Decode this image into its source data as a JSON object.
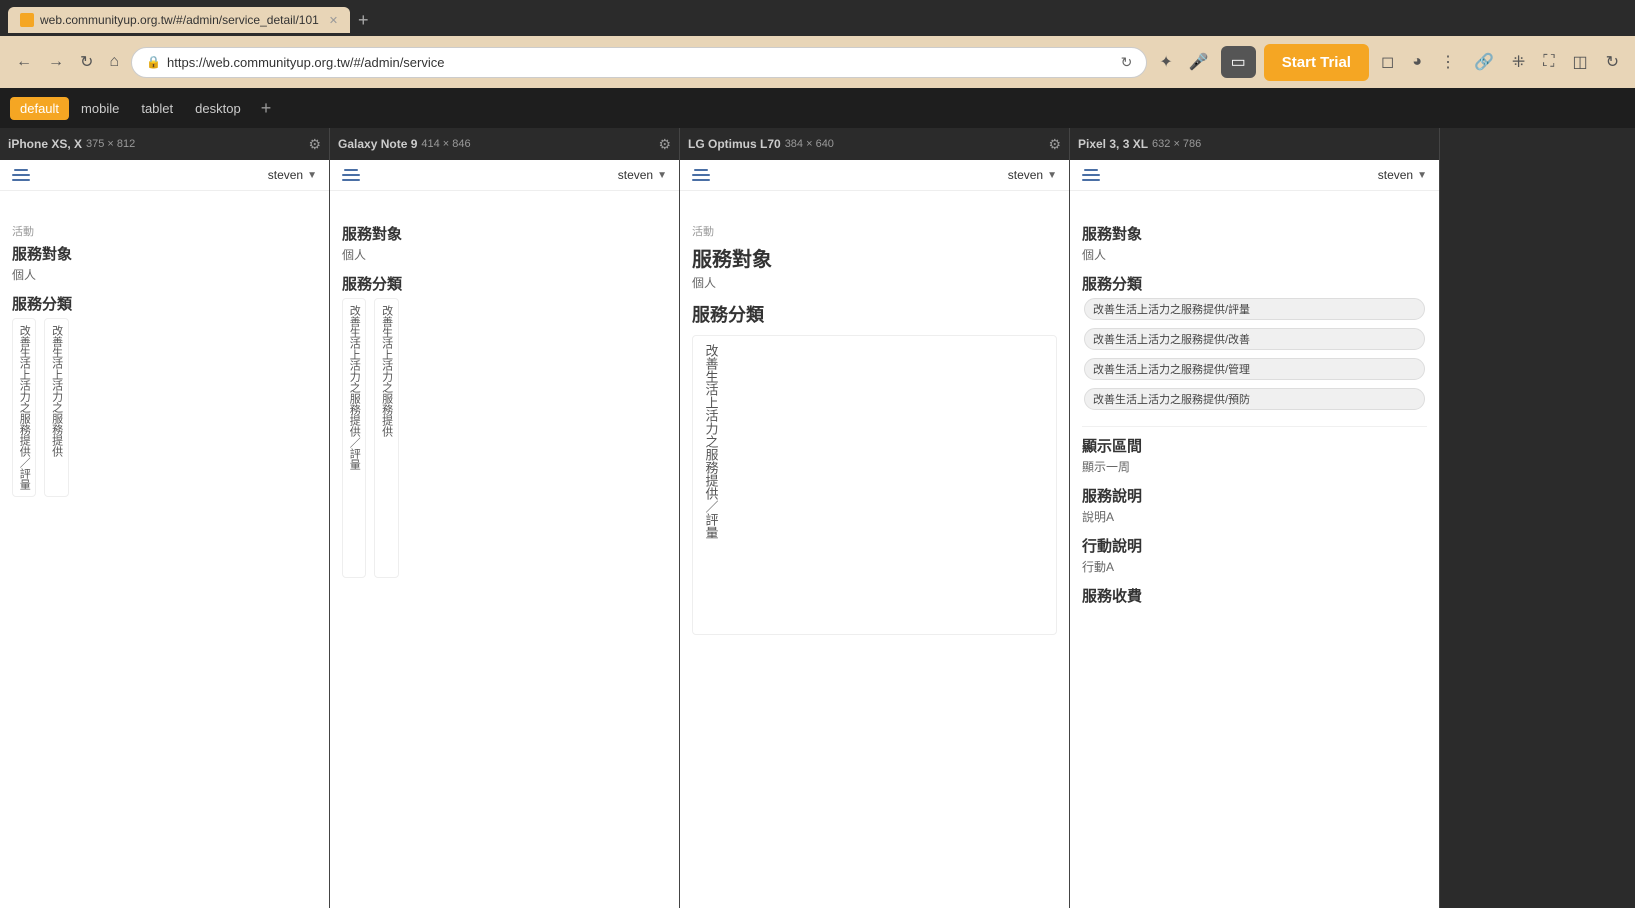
{
  "browser": {
    "url": "https://web.communityup.org.tw/#/admin/service",
    "url_full": "https://web.communityup.org.tw/#/admin/service_detail/101",
    "start_trial": "Start Trial"
  },
  "tabs": [
    {
      "label": "default",
      "active": true
    },
    {
      "label": "mobile",
      "active": false
    },
    {
      "label": "tablet",
      "active": false
    },
    {
      "label": "desktop",
      "active": false
    }
  ],
  "devices": [
    {
      "id": "iphone",
      "name": "iPhone XS, X",
      "size": "375 × 812",
      "user": "steven",
      "content": {
        "activity_label": "活動",
        "target_title": "服務對象",
        "target_value": "個人",
        "category_title": "服務分類",
        "category_items_vertical": [
          "改善生活上活力之服務提供／評量",
          "改善生活上活力之服務提供"
        ]
      }
    },
    {
      "id": "galaxy",
      "name": "Galaxy Note 9",
      "size": "414 × 846",
      "user": "steven",
      "content": {
        "target_title": "服務對象",
        "target_value": "個人",
        "category_title": "服務分類",
        "category_items_vertical": [
          "改善生活上活力之服務提供／評量",
          "改善生活上活力之服務提供"
        ]
      }
    },
    {
      "id": "lg",
      "name": "LG Optimus L70",
      "size": "384 × 640",
      "user": "steven",
      "content": {
        "activity_label": "活動",
        "target_title": "服務對象",
        "target_value": "個人",
        "category_title": "服務分類",
        "category_items_vertical": [
          "改善生活上活力之服務提供／評量"
        ]
      }
    },
    {
      "id": "pixel",
      "name": "Pixel 3, 3 XL",
      "size": "632 × 786",
      "user": "steven",
      "content": {
        "target_title": "服務對象",
        "target_value": "個人",
        "category_title": "服務分類",
        "category_tags": [
          "改善生活上活力之服務提供/評量",
          "改善生活上活力之服務提供/改善",
          "改善生活上活力之服務提供/管理",
          "改善生活上活力之服務提供/預防"
        ],
        "display_title": "顯示區間",
        "display_value": "顯示一周",
        "desc_title": "服務說明",
        "desc_value": "說明A",
        "action_title": "行動說明",
        "action_value": "行動A",
        "fee_title": "服務收費"
      }
    }
  ]
}
